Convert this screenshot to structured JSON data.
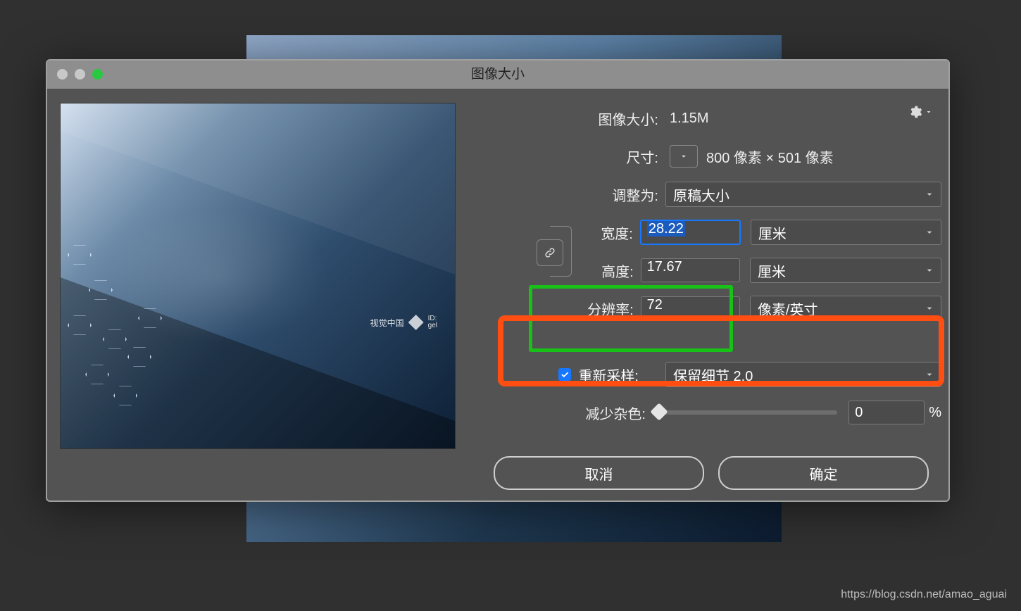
{
  "window": {
    "title": "图像大小"
  },
  "info": {
    "size_label": "图像大小:",
    "size_value": "1.15M",
    "dim_label": "尺寸:",
    "dim_value": "800 像素  ×  501 像素"
  },
  "fit": {
    "label": "调整为:",
    "value": "原稿大小"
  },
  "width": {
    "label": "宽度:",
    "value": "28.22",
    "unit": "厘米"
  },
  "height": {
    "label": "高度:",
    "value": "17.67",
    "unit": "厘米"
  },
  "resolution": {
    "label": "分辨率:",
    "value": "72",
    "unit": "像素/英寸"
  },
  "resample": {
    "label": "重新采样:",
    "checked": true,
    "method": "保留细节 2.0"
  },
  "noise": {
    "label": "减少杂色:",
    "value": "0",
    "suffix": "%"
  },
  "buttons": {
    "cancel": "取消",
    "ok": "确定"
  },
  "watermark": {
    "brand": "视觉中国",
    "id_label": "ID:",
    "id_value": "gel"
  },
  "credit": "https://blog.csdn.net/amao_aguai"
}
